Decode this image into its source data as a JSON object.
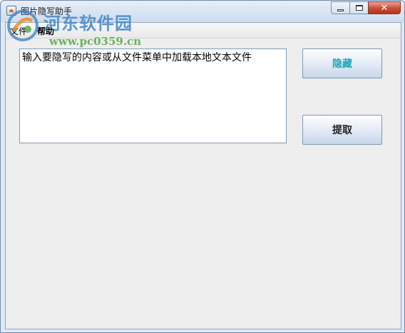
{
  "window": {
    "title": "图片隐写助手",
    "controls": {
      "minimize_icon": "minimize-icon",
      "maximize_icon": "maximize-icon",
      "close_icon": "close-icon",
      "close_glyph": "✕"
    }
  },
  "menubar": {
    "items": [
      {
        "label": "文件"
      },
      {
        "label": "帮助"
      }
    ]
  },
  "main": {
    "text_input": {
      "value": "输入要隐写的内容或从文件菜单中加载本地文本文件"
    },
    "buttons": {
      "hide_label": "隐藏",
      "extract_label": "提取"
    }
  },
  "watermark": {
    "site_name": "河东软件园",
    "url": "www.pc0359.cn"
  },
  "colors": {
    "hide_button_text": "#1fa8b8",
    "close_button": "#c94b36",
    "window_frame": "#dfe9f4"
  }
}
